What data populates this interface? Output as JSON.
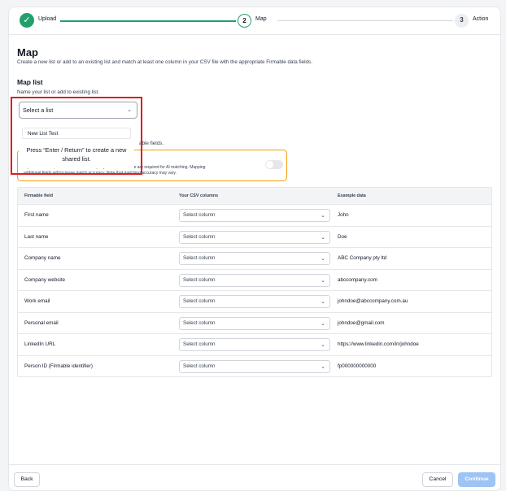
{
  "stepper": {
    "steps": [
      {
        "label": "Upload",
        "state": "done"
      },
      {
        "number": "2",
        "label": "Map",
        "state": "current"
      },
      {
        "number": "3",
        "label": "Action",
        "state": "upcoming"
      }
    ],
    "colors": {
      "done": "#22a06b",
      "current_border": "#86c7a8"
    }
  },
  "page": {
    "title": "Map",
    "subtitle": "Create a new list or add to an existing list and match at least one column in your CSV file with the appropriate Firmable data fields."
  },
  "map_list": {
    "heading": "Map list",
    "hint": "Name your list or add to existing list.",
    "select_placeholder": "Select a list",
    "dropdown_item": "New List Test",
    "dropdown_message": "Press “Enter / Return” to create a new shared list.",
    "partial_text": "able fields."
  },
  "ai_notice": {
    "line1": "A person's name, email or contact's company name or website are required for AI matching. Mapping",
    "line2": "additional fields will increase match accuracy. Note that matching accuracy may vary.",
    "toggle_on": false
  },
  "table": {
    "headers": {
      "field": "Firmable field",
      "csv": "Your CSV columns",
      "example": "Example data"
    },
    "select_placeholder": "Select column",
    "rows": [
      {
        "field": "First name",
        "example": "John"
      },
      {
        "field": "Last name",
        "example": "Doe"
      },
      {
        "field": "Company name",
        "example": "ABC Company pty ltd"
      },
      {
        "field": "Company website",
        "example": "abccompany.com"
      },
      {
        "field": "Work email",
        "example": "johndoe@abccompany.com.au"
      },
      {
        "field": "Personal email",
        "example": "johndoe@gmail.com"
      },
      {
        "field": "LinkedIn URL",
        "example": "https://www.linkedin.com/in/johndoe"
      },
      {
        "field": "Person ID (Firmable identifier)",
        "example": "fp000000000000"
      }
    ]
  },
  "footer": {
    "back": "Back",
    "cancel": "Cancel",
    "continue": "Continue"
  },
  "accent": {
    "highlight_border": "#e11d1d",
    "warning_border": "#f59e0b",
    "primary_disabled": "#9ec3f5"
  }
}
